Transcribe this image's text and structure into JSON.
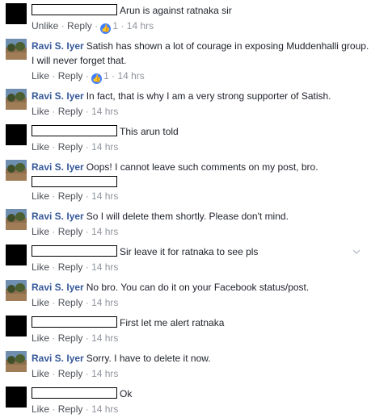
{
  "comments": [
    {
      "id": "c1",
      "avatar": "black",
      "redacted": true,
      "author": "",
      "text": "Arun is against ratnaka sir",
      "actions": {
        "primary": "Unlike",
        "reply": "Reply",
        "likes": "1",
        "time": "14 hrs"
      }
    },
    {
      "id": "c2",
      "avatar": "photo",
      "redacted": false,
      "author": "Ravi S. Iyer",
      "text": "Satish has shown a lot of courage in exposing Muddenhalli group. I will never forget that.",
      "actions": {
        "primary": "Like",
        "reply": "Reply",
        "likes": "1",
        "time": "14 hrs"
      }
    },
    {
      "id": "c3",
      "avatar": "photo",
      "redacted": false,
      "author": "Ravi S. Iyer",
      "text": "In fact, that is why I am a very strong supporter of Satish.",
      "actions": {
        "primary": "Like",
        "reply": "Reply",
        "likes": "",
        "time": "14 hrs"
      }
    },
    {
      "id": "c4",
      "avatar": "black",
      "redacted": true,
      "author": "",
      "text": "This arun told",
      "actions": {
        "primary": "Like",
        "reply": "Reply",
        "likes": "",
        "time": "14 hrs"
      }
    },
    {
      "id": "c5",
      "avatar": "photo",
      "redacted": false,
      "author": "Ravi S. Iyer",
      "text": "Oops! I cannot leave such comments on my post, bro.",
      "actions": {
        "primary": "Like",
        "reply": "Reply",
        "likes": "",
        "time": "14 hrs"
      }
    },
    {
      "id": "c6",
      "avatar": "photo",
      "redacted": false,
      "author": "Ravi S. Iyer",
      "text": "So I will delete them shortly. Please don't mind.",
      "actions": {
        "primary": "Like",
        "reply": "Reply",
        "likes": "",
        "time": "14 hrs"
      }
    },
    {
      "id": "c7",
      "avatar": "black",
      "redacted": true,
      "author": "",
      "text": "Sir leave it for ratnaka to see pls",
      "actions": {
        "primary": "Like",
        "reply": "Reply",
        "likes": "",
        "time": "14 hrs"
      }
    },
    {
      "id": "c8",
      "avatar": "photo",
      "redacted": false,
      "author": "Ravi S. Iyer",
      "text": "No bro. You can do it on your Facebook status/post.",
      "actions": {
        "primary": "Like",
        "reply": "Reply",
        "likes": "",
        "time": "14 hrs"
      }
    },
    {
      "id": "c9",
      "avatar": "black",
      "redacted": true,
      "author": "",
      "text": "First let me alert ratnaka",
      "actions": {
        "primary": "Like",
        "reply": "Reply",
        "likes": "",
        "time": "14 hrs"
      }
    },
    {
      "id": "c10",
      "avatar": "photo",
      "redacted": false,
      "author": "Ravi S. Iyer",
      "text": "Sorry. I have to delete it now.",
      "actions": {
        "primary": "Like",
        "reply": "Reply",
        "likes": "",
        "time": "14 hrs"
      }
    },
    {
      "id": "c11",
      "avatar": "black",
      "redacted": true,
      "author": "",
      "text": "Ok",
      "actions": {
        "primary": "Like",
        "reply": "Reply",
        "likes": "",
        "time": "14 hrs"
      }
    }
  ],
  "separator": "·",
  "colors": {
    "author": "#365899",
    "like_badge": "#4080ff",
    "meta": "#90949c"
  }
}
